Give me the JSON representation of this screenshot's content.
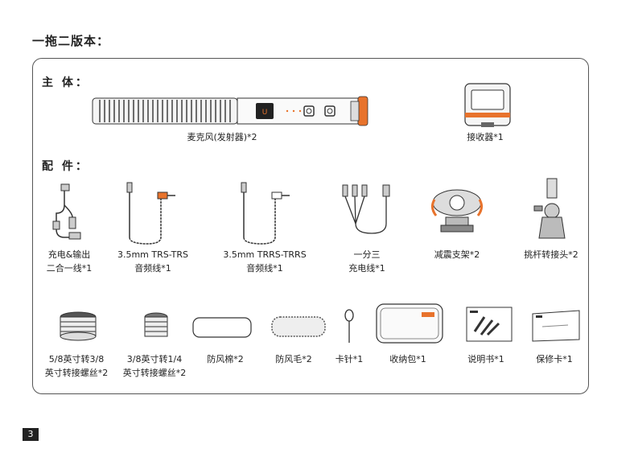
{
  "page_title": "一拖二版本：",
  "sections": {
    "main_body": "主  体：",
    "accessories": "配  件："
  },
  "main_items": {
    "mic": "麦克风(发射器)*2",
    "receiver": "接收器*1"
  },
  "accessory_row1": [
    {
      "line1": "充电&输出",
      "line2": "二合一线*1"
    },
    {
      "line1": "3.5mm TRS-TRS",
      "line2": "音频线*1"
    },
    {
      "line1": "3.5mm TRRS-TRRS",
      "line2": "音频线*1"
    },
    {
      "line1": "一分三",
      "line2": "充电线*1"
    },
    {
      "line1": "减震支架*2",
      "line2": ""
    },
    {
      "line1": "挑杆转接头*2",
      "line2": ""
    }
  ],
  "accessory_row2": [
    {
      "line1": "5/8英寸转3/8",
      "line2": "英寸转接螺丝*2"
    },
    {
      "line1": "3/8英寸转1/4",
      "line2": "英寸转接螺丝*2"
    },
    {
      "line1": "防风棉*2",
      "line2": ""
    },
    {
      "line1": "防风毛*2",
      "line2": ""
    },
    {
      "line1": "卡针*1",
      "line2": ""
    },
    {
      "line1": "收纳包*1",
      "line2": ""
    },
    {
      "line1": "说明书*1",
      "line2": ""
    },
    {
      "line1": "保修卡*1",
      "line2": ""
    }
  ],
  "page_number": "3",
  "colors": {
    "accent": "#e8732c",
    "text": "#222222",
    "border": "#555555"
  }
}
